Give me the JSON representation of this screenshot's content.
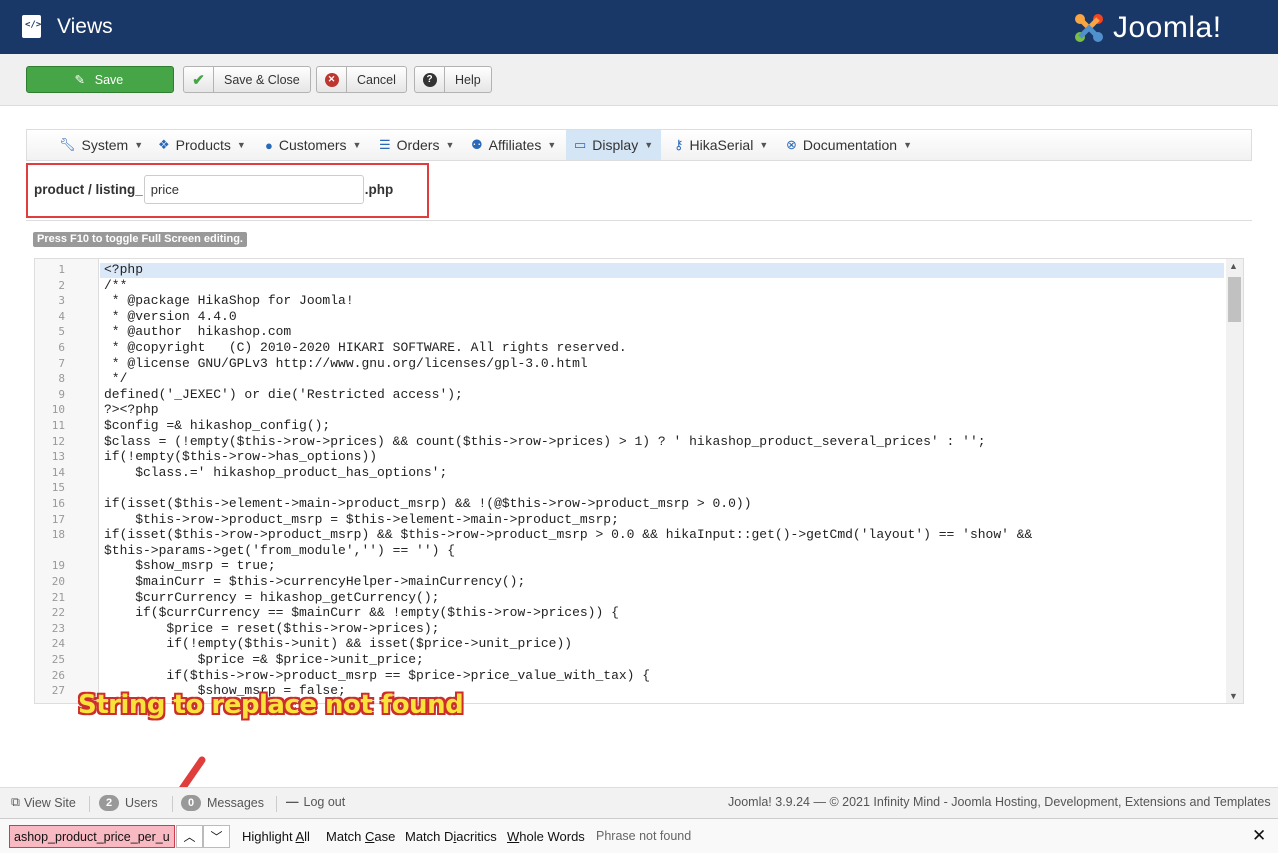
{
  "header": {
    "title": "Views",
    "logo_text": "Joomla!"
  },
  "toolbar": {
    "save_label": "Save",
    "save_close_label": "Save & Close",
    "cancel_label": "Cancel",
    "help_label": "Help"
  },
  "menu": {
    "items": [
      {
        "label": "System",
        "icon": "wrench-icon"
      },
      {
        "label": "Products",
        "icon": "cubes-icon"
      },
      {
        "label": "Customers",
        "icon": "user-icon"
      },
      {
        "label": "Orders",
        "icon": "list-icon"
      },
      {
        "label": "Affiliates",
        "icon": "users-icon"
      },
      {
        "label": "Display",
        "icon": "monitor-icon"
      },
      {
        "label": "HikaSerial",
        "icon": "key-icon"
      },
      {
        "label": "Documentation",
        "icon": "lifebuoy-icon"
      }
    ]
  },
  "file": {
    "prefix": "product / listing_",
    "name_value": "price",
    "suffix": ".php"
  },
  "editor": {
    "hint": "Press F10 to toggle Full Screen editing.",
    "line_numbers": [
      "1",
      "2",
      "3",
      "4",
      "5",
      "6",
      "7",
      "8",
      "9",
      "10",
      "11",
      "12",
      "13",
      "14",
      "15",
      "16",
      "17",
      "18",
      "",
      "19",
      "20",
      "21",
      "22",
      "23",
      "24",
      "25",
      "26",
      "27"
    ],
    "lines": [
      "<?php",
      "/**",
      " * @package HikaShop for Joomla!",
      " * @version 4.4.0",
      " * @author  hikashop.com",
      " * @copyright   (C) 2010-2020 HIKARI SOFTWARE. All rights reserved.",
      " * @license GNU/GPLv3 http://www.gnu.org/licenses/gpl-3.0.html",
      " */",
      "defined('_JEXEC') or die('Restricted access');",
      "?><?php",
      "$config =& hikashop_config();",
      "$class = (!empty($this->row->prices) && count($this->row->prices) > 1) ? ' hikashop_product_several_prices' : '';",
      "if(!empty($this->row->has_options))",
      "    $class.=' hikashop_product_has_options';",
      "",
      "if(isset($this->element->main->product_msrp) && !(@$this->row->product_msrp > 0.0))",
      "    $this->row->product_msrp = $this->element->main->product_msrp;",
      "if(isset($this->row->product_msrp) && $this->row->product_msrp > 0.0 && hikaInput::get()->getCmd('layout') == 'show' &&",
      "$this->params->get('from_module','') == '') {",
      "    $show_msrp = true;",
      "    $mainCurr = $this->currencyHelper->mainCurrency();",
      "    $currCurrency = hikashop_getCurrency();",
      "    if($currCurrency == $mainCurr && !empty($this->row->prices)) {",
      "        $price = reset($this->row->prices);",
      "        if(!empty($this->unit) && isset($price->unit_price))",
      "            $price =& $price->unit_price;",
      "        if($this->row->product_msrp == $price->price_value_with_tax) {",
      "            $show_msrp = false;"
    ]
  },
  "annotation": "String to replace not found",
  "statusbar": {
    "view_site": "View Site",
    "users_count": "2",
    "users_label": "Users",
    "messages_count": "0",
    "messages_label": "Messages",
    "logout": "Log out",
    "footer": "Joomla! 3.9.24 — © 2021 Infinity Mind - Joomla Hosting, Development, Extensions and Templates"
  },
  "findbar": {
    "query": "ashop_product_price_per_unit",
    "highlight_all_pre": "Highlight ",
    "highlight_all_u": "A",
    "highlight_all_post": "ll",
    "match_case_pre": "Match ",
    "match_case_u": "C",
    "match_case_post": "ase",
    "match_diacritics_pre": "Match D",
    "match_diacritics_u": "i",
    "match_diacritics_post": "acritics",
    "whole_words_pre": "",
    "whole_words_u": "W",
    "whole_words_post": "hole Words",
    "status": "Phrase not found"
  },
  "colors": {
    "header_bg": "#1a3867",
    "save_green": "#46a546",
    "highlight_red": "#e03d3d",
    "annotation_yellow": "#f9e33a",
    "find_notfound_bg": "#f8b9c2"
  }
}
